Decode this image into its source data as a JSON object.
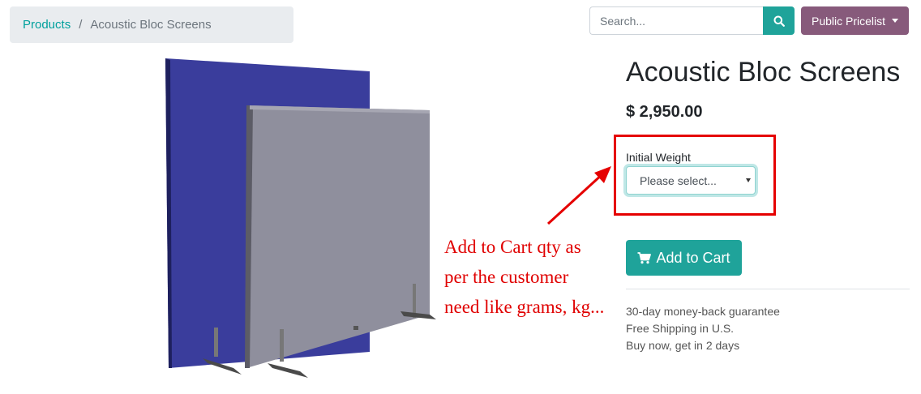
{
  "breadcrumb": {
    "parent": "Products",
    "separator": "/",
    "current": "Acoustic Bloc Screens"
  },
  "search": {
    "placeholder": "Search..."
  },
  "pricelist": {
    "label": "Public Pricelist"
  },
  "product": {
    "name": "Acoustic Bloc Screens",
    "price": "$ 2,950.00",
    "attribute_label": "Initial Weight",
    "attribute_selected": "Please select...",
    "add_to_cart": "Add to Cart",
    "terms": [
      "30-day money-back guarantee",
      "Free Shipping in U.S.",
      "Buy now, get in 2 days"
    ]
  },
  "annotation": {
    "lines": [
      "Add to Cart qty as",
      "per the customer",
      "need like grams, kg..."
    ]
  },
  "colors": {
    "primary": "#1fa39a",
    "pricelist": "#875a7b",
    "annotation": "#e00000",
    "screen_blue": "#3a3d9c",
    "screen_grey": "#8f8f9d"
  }
}
